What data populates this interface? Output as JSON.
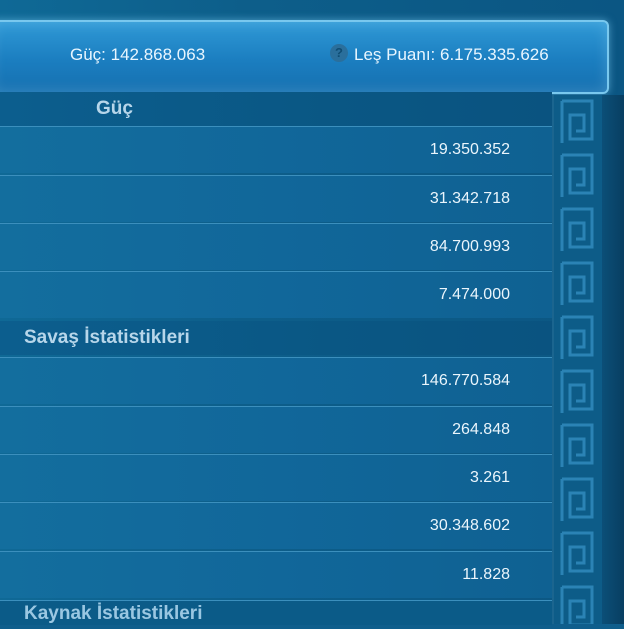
{
  "header": {
    "power_label": "Güç: 142.868.063",
    "kill_points_label": "Leş Puanı: 6.175.335.626",
    "help_icon": "?"
  },
  "sections": {
    "power": {
      "title": "Güç",
      "values": [
        "19.350.352",
        "31.342.718",
        "84.700.993",
        "7.474.000"
      ]
    },
    "battle": {
      "title": "Savaş İstatistikleri",
      "values": [
        "146.770.584",
        "264.848",
        "3.261",
        "30.348.602",
        "11.828"
      ]
    },
    "next": {
      "title": "Kaynak İstatistikleri"
    }
  }
}
